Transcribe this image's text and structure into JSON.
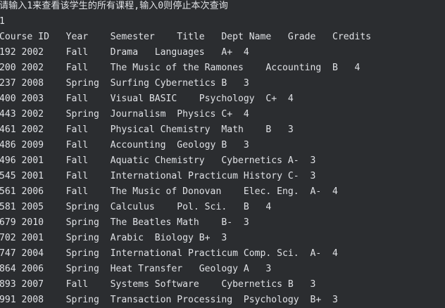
{
  "console": {
    "prompt": "请输入1来查看该学生的所有课程,输入0则停止本次查询",
    "user_input": "1",
    "header": "Course ID   Year    Semester    Title   Dept Name   Grade   Credits",
    "rows": [
      "192 2002    Fall    Drama   Languages   A+  4",
      "200 2002    Fall    The Music of the Ramones    Accounting  B   4",
      "237 2008    Spring  Surfing Cybernetics B   3",
      "400 2003    Fall    Visual BASIC    Psychology  C+  4",
      "443 2002    Spring  Journalism  Physics C+  4",
      "461 2002    Fall    Physical Chemistry  Math    B   3",
      "486 2009    Fall    Accounting  Geology B   3",
      "496 2001    Fall    Aquatic Chemistry   Cybernetics A-  3",
      "545 2001    Fall    International Practicum History C-  3",
      "561 2006    Fall    The Music of Donovan    Elec. Eng.  A-  4",
      "581 2005    Spring  Calculus    Pol. Sci.   B   4",
      "679 2010    Spring  The Beatles Math    B-  3",
      "702 2001    Spring  Arabic  Biology B+  3",
      "747 2004    Spring  International Practicum Comp. Sci.  A-  4",
      "864 2006    Spring  Heat Transfer   Geology A   3",
      "893 2007    Fall    Systems Software    Cybernetics B   3",
      "991 2008    Spring  Transaction Processing  Psychology  B+  3"
    ]
  }
}
